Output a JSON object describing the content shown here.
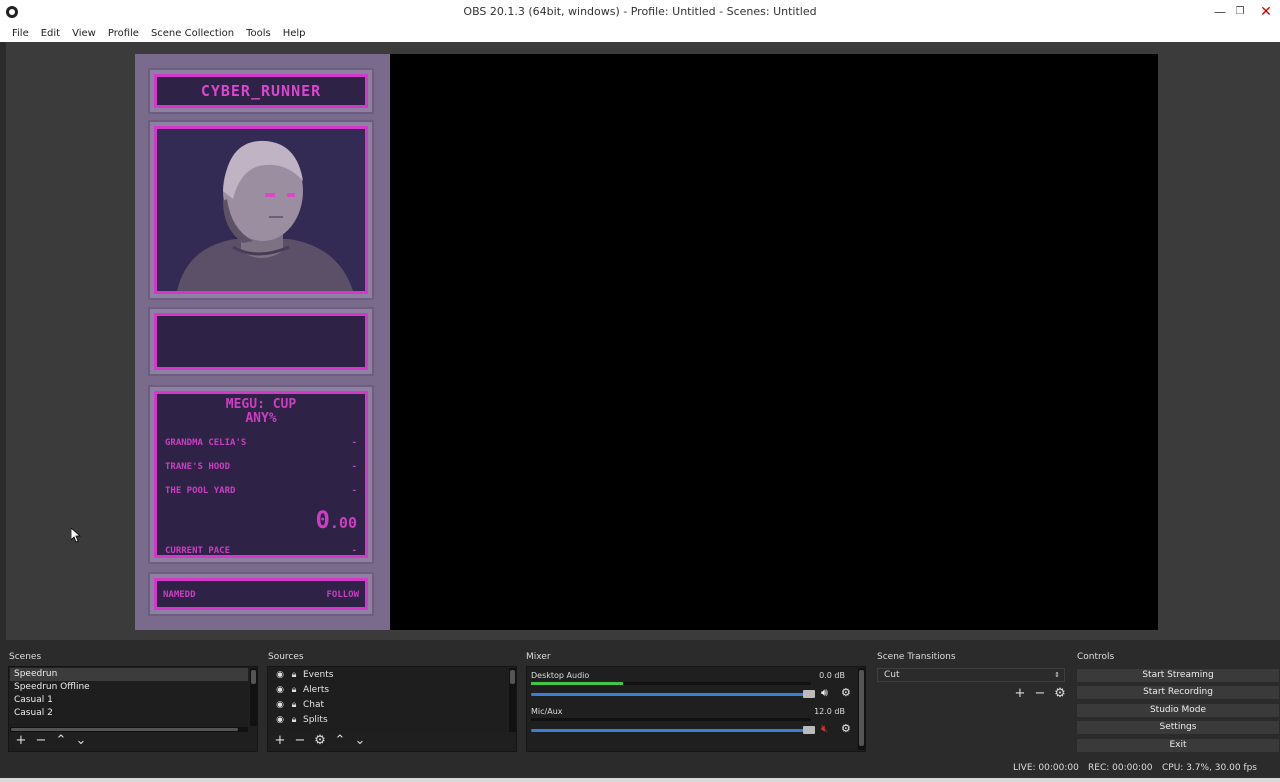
{
  "window": {
    "title": "OBS 20.1.3 (64bit, windows) - Profile: Untitled - Scenes: Untitled",
    "minimize": "—",
    "restore": "❐",
    "close": "✕"
  },
  "menu": [
    "File",
    "Edit",
    "View",
    "Profile",
    "Scene Collection",
    "Tools",
    "Help"
  ],
  "overlay": {
    "runner_name": "CYBER_RUNNER",
    "game_title": "MEGU: CUP",
    "category": "ANY%",
    "splits": [
      {
        "name": "GRANDMA CELIA'S",
        "time": "-"
      },
      {
        "name": "TRANE'S HOOD",
        "time": "-"
      },
      {
        "name": "THE POOL YARD",
        "time": "-"
      }
    ],
    "timer_main": "0",
    "timer_decimals": ".00",
    "pace_label": "CURRENT PACE",
    "pace_value": "-",
    "footer_left": "NAMEDD",
    "footer_right": "FOLLOW"
  },
  "docks": {
    "scenes_label": "Scenes",
    "sources_label": "Sources",
    "mixer_label": "Mixer",
    "transitions_label": "Scene Transitions",
    "controls_label": "Controls"
  },
  "scenes": [
    "Speedrun",
    "Speedrun Offline",
    "Casual 1",
    "Casual 2"
  ],
  "sources": [
    "Events",
    "Alerts",
    "Chat",
    "Splits"
  ],
  "mixer": {
    "channels": [
      {
        "name": "Desktop Audio",
        "db": "0.0 dB",
        "level": 0.33,
        "volume": 1.0,
        "muted": false
      },
      {
        "name": "Mic/Aux",
        "db": "12.0 dB",
        "level": 0.0,
        "volume": 1.0,
        "muted": true
      }
    ]
  },
  "transitions": {
    "selected": "Cut"
  },
  "controls": {
    "start_streaming": "Start Streaming",
    "start_recording": "Start Recording",
    "studio_mode": "Studio Mode",
    "settings": "Settings",
    "exit": "Exit"
  },
  "status": {
    "live": "LIVE: 00:00:00",
    "rec": "REC: 00:00:00",
    "cpu": "CPU: 3.7%, 30.00 fps"
  },
  "colors": {
    "overlay_accent": "#d339c8",
    "meter_green": "#43c443",
    "volume_blue": "#3a7fd5",
    "mute_red": "#e03030"
  }
}
